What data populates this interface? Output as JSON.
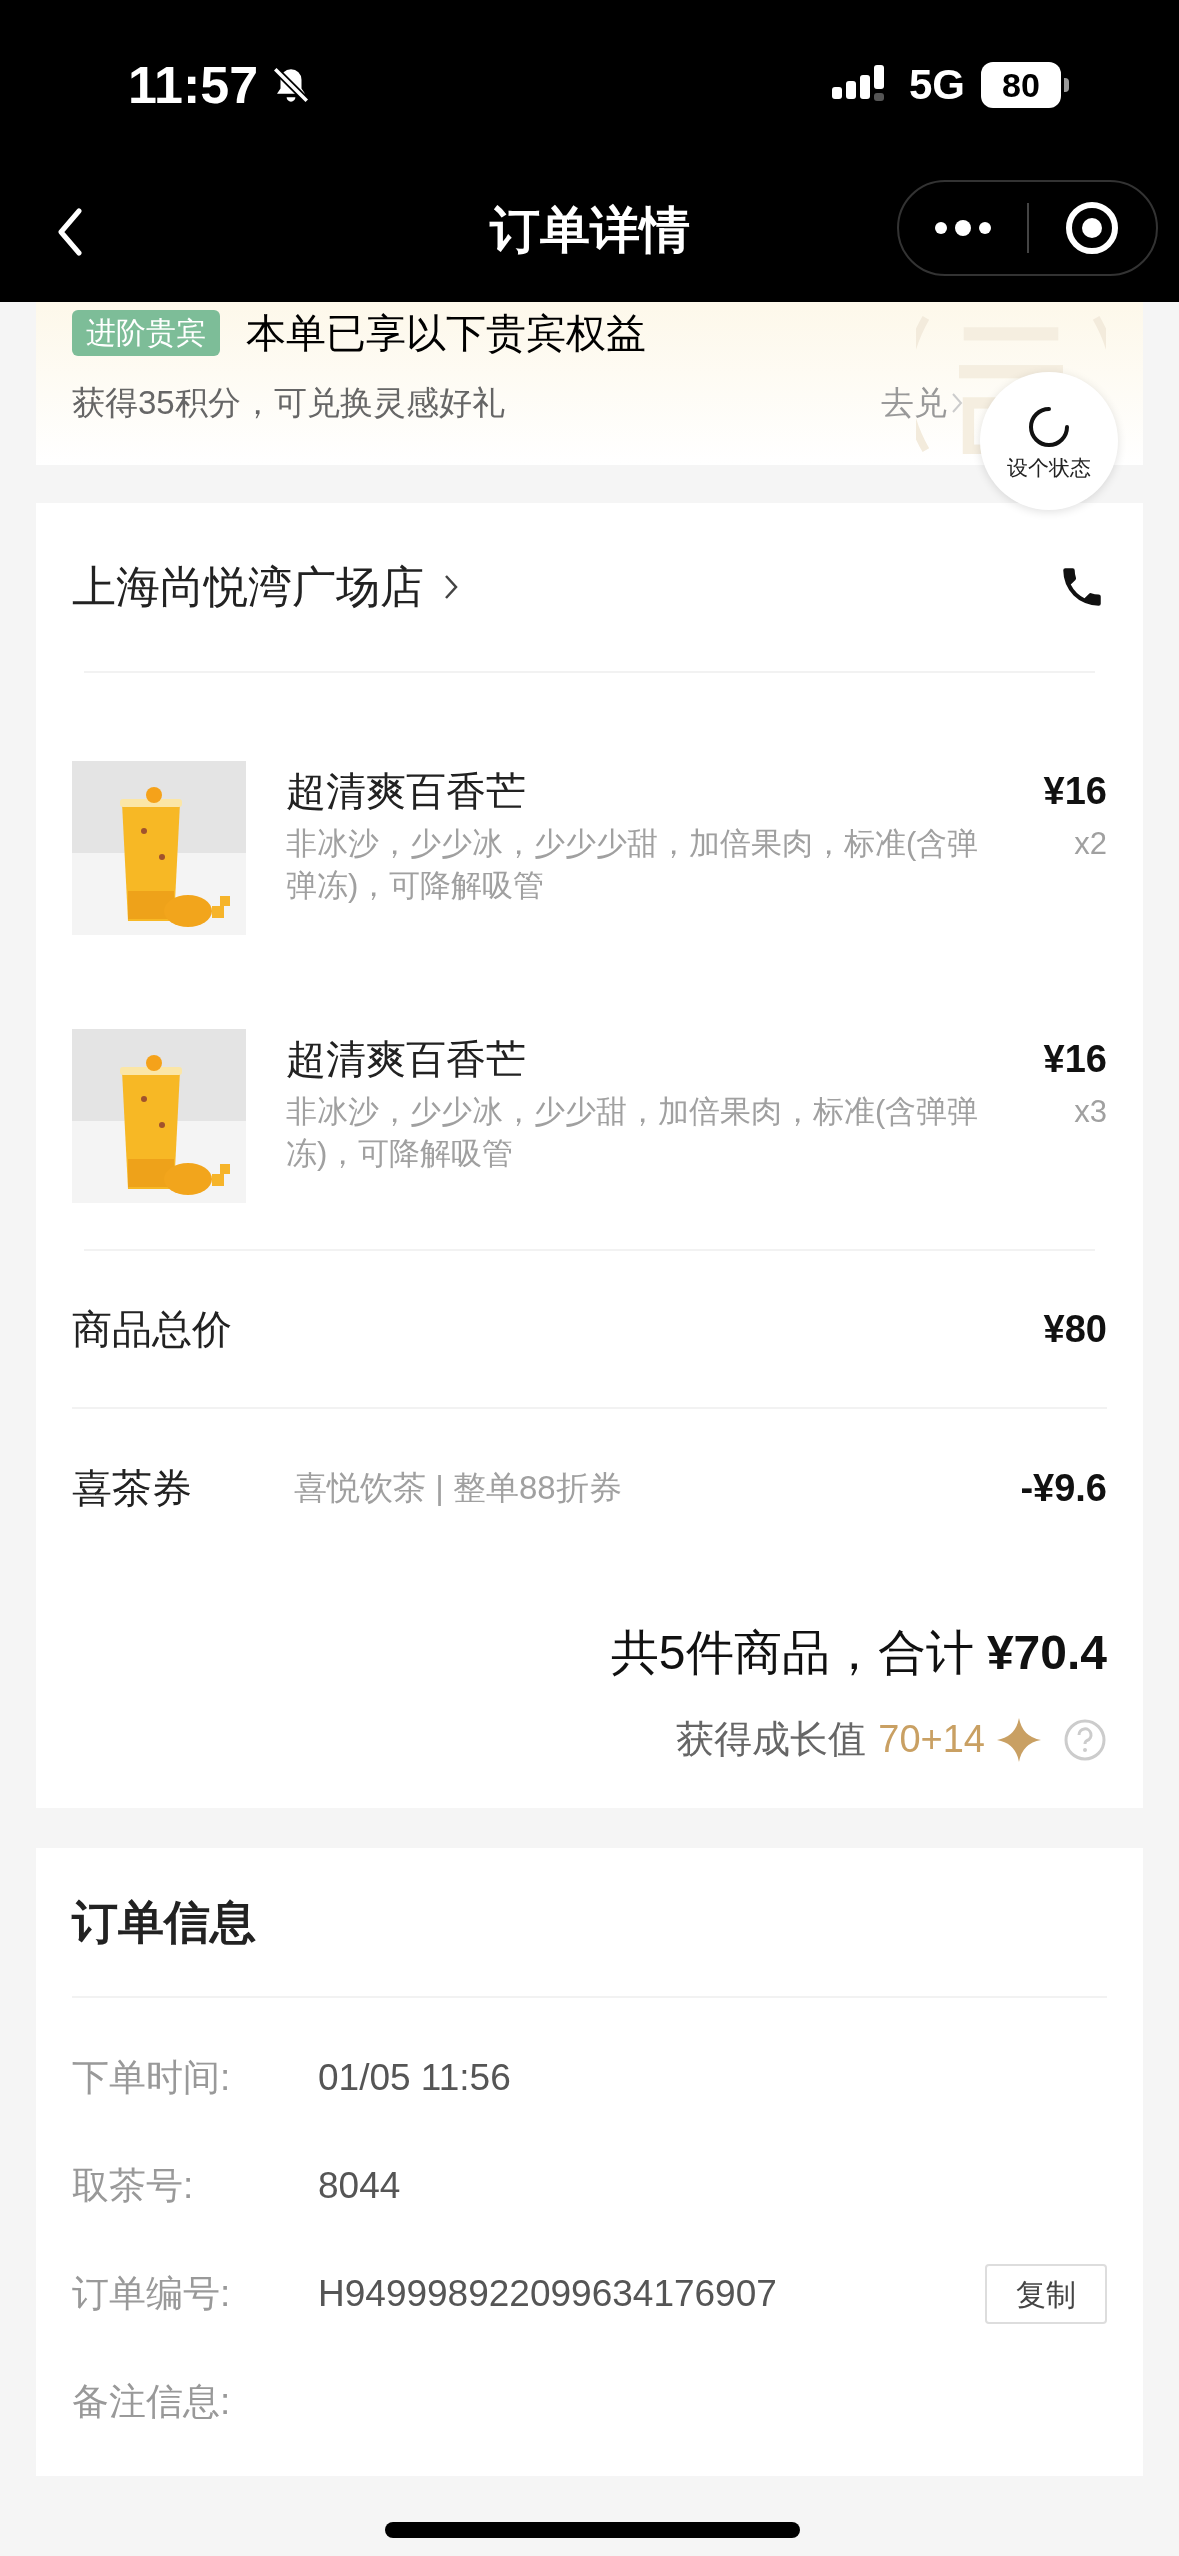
{
  "status_bar": {
    "time": "11:57",
    "network": "5G",
    "battery": "80"
  },
  "nav": {
    "title": "订单详情"
  },
  "vip_card": {
    "badge": "进阶贵宾",
    "title": "本单已享以下贵宾权益",
    "points": "获得35积分，可兑换灵感好礼",
    "link": "去兑"
  },
  "floating_button": {
    "label": "设个状态"
  },
  "store": {
    "name": "上海尚悦湾广场店"
  },
  "items": [
    {
      "name": "超清爽百香芒",
      "options": "非冰沙，少少冰，少少少甜，加倍果肉，标准(含弹弹冻)，可降解吸管",
      "price": "¥16",
      "quantity": "x2"
    },
    {
      "name": "超清爽百香芒",
      "options": "非冰沙，少少冰，少少甜，加倍果肉，标准(含弹弹冻)，可降解吸管",
      "price": "¥16",
      "quantity": "x3"
    }
  ],
  "summary": [
    {
      "label": "商品总价",
      "value": "¥80"
    },
    {
      "label": "喜茶券",
      "detail": "喜悦饮茶 | 整单88折券",
      "value": "-¥9.6"
    }
  ],
  "total": "共5件商品，合计 **¥70.4**",
  "growth": {
    "label": "获得成长值",
    "value": "70+14"
  },
  "order_info": {
    "title": "订单信息",
    "rows": [
      {
        "label": "下单时间:",
        "value": "01/05 11:56"
      },
      {
        "label": "取茶号:",
        "value": "8044"
      },
      {
        "label": "订单编号:",
        "value": "H949998922099634176907",
        "action": "复制"
      },
      {
        "label": "备注信息:"
      }
    ]
  }
}
